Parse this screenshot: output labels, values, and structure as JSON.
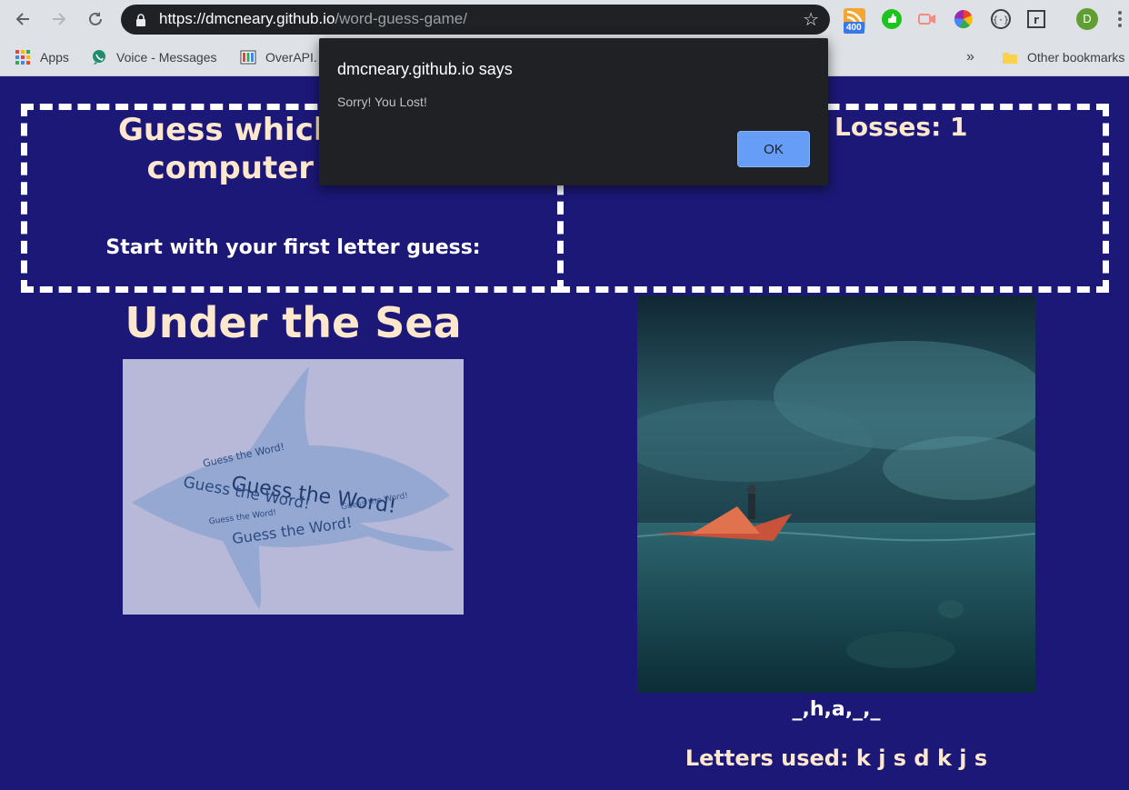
{
  "browser": {
    "url_host": "https://dmcneary.github.io",
    "url_path": "/word-guess-game/",
    "extension_badge": "400",
    "profile_initial": "D",
    "bookmarks": [
      {
        "label": "Apps",
        "icon": "apps-grid-icon"
      },
      {
        "label": "Voice - Messages",
        "icon": "voice-icon"
      },
      {
        "label": "OverAPI.",
        "icon": "overapi-icon"
      }
    ],
    "bookmarks_overflow": "»",
    "other_bookmarks": "Other bookmarks"
  },
  "dialog": {
    "title": "dmcneary.github.io says",
    "message": "Sorry! You Lost!",
    "ok_label": "OK"
  },
  "game": {
    "headline": "Guess which mo the computer about!",
    "prompt": "Start with your first letter guess:",
    "losses": "Losses: 1",
    "theme": "Under the Sea",
    "word_display": "_,h,a,_,_",
    "letters_used": "Letters used: k j s d k j s",
    "wordcloud_text": "Guess the Word!"
  },
  "colors": {
    "page_bg": "#1c1878",
    "heading": "#fde7cd",
    "dialog_bg": "#202124",
    "ok_button": "#669df6"
  }
}
